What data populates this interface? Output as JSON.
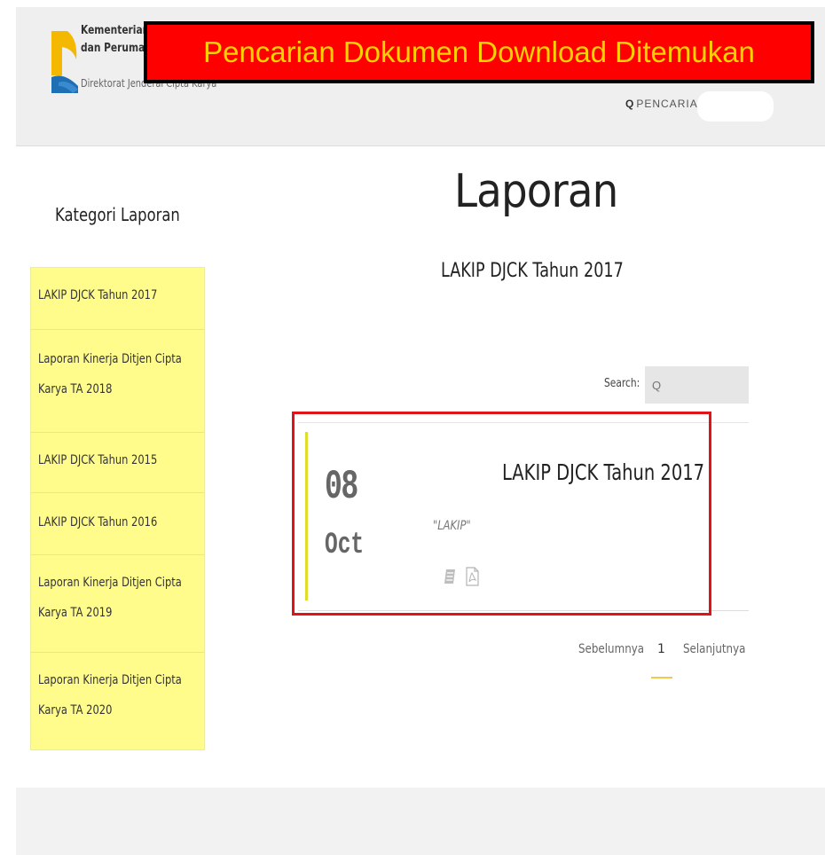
{
  "header": {
    "org_line1": "Kementerian Pe",
    "org_line2": "dan Perumahan",
    "org_line3": "Direktorat Jenderal Cipta Karya",
    "banner": "Pencarian Dokumen Download Ditemukan",
    "search_link_icon": "Q",
    "search_link": "PENCARIAN",
    "search_value": ""
  },
  "main": {
    "page_title": "Laporan",
    "sub_title": "LAKIP DJCK Tahun 2017",
    "search_label": "Search:",
    "search_placeholder": "Q"
  },
  "sidebar": {
    "title": "Kategori Laporan",
    "items": [
      {
        "label": "LAKIP DJCK Tahun 2017"
      },
      {
        "label": "Laporan Kinerja Ditjen Cipta Karya TA 2018"
      },
      {
        "label": "LAKIP DJCK Tahun 2015"
      },
      {
        "label": "LAKIP DJCK Tahun 2016"
      },
      {
        "label": "Laporan Kinerja Ditjen Cipta Karya TA 2019"
      },
      {
        "label": "Laporan Kinerja Ditjen Cipta Karya TA 2020"
      }
    ]
  },
  "result": {
    "day": "08",
    "month": "Oct",
    "title": "LAKIP DJCK Tahun 2017",
    "tag": "\"LAKIP\"",
    "icons": [
      "document-icon",
      "pdf-icon"
    ]
  },
  "pager": {
    "prev": "Sebelumnya",
    "current": "1",
    "next": "Selanjutnya"
  },
  "colors": {
    "banner_bg": "#ff0000",
    "banner_text": "#ffd200",
    "sidebar_bg": "#fffc8c",
    "highlight": "#e0131a",
    "accent": "#e0dd2a"
  }
}
